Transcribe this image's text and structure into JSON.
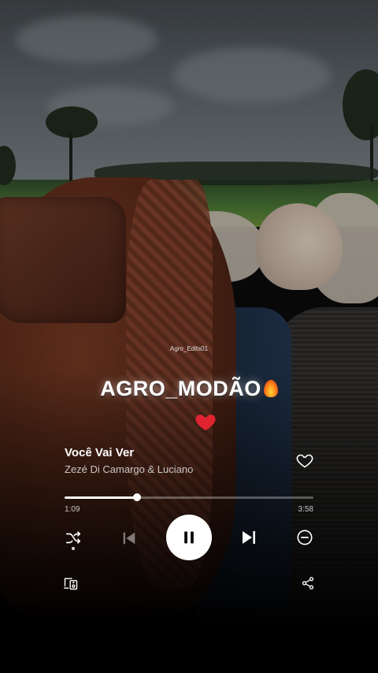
{
  "overlay": {
    "watermark": "Agro_Edits01",
    "headline": "AGRO_MODÃO"
  },
  "player": {
    "track_title": "Você Vai Ver",
    "artist": "Zezé Di Camargo & Luciano",
    "elapsed": "1:09",
    "duration": "3:58",
    "progress_fraction": 0.29,
    "state": "playing",
    "liked": false
  },
  "icons": {
    "fire": "fire-emoji",
    "heart": "red-heart-emoji",
    "like": "heart-outline-icon",
    "shuffle": "shuffle-icon",
    "previous": "skip-previous-icon",
    "play_pause": "pause-icon",
    "next": "skip-next-icon",
    "remove": "minus-circle-icon",
    "devices": "connect-device-icon",
    "share": "share-icon"
  },
  "colors": {
    "heart_red": "#e0242f",
    "text_primary": "#ffffff",
    "text_secondary": "#bfbfbf"
  }
}
